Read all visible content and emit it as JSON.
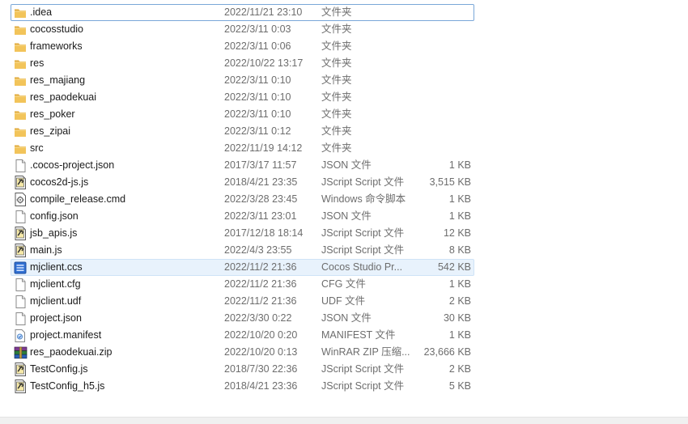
{
  "files": [
    {
      "name": ".idea",
      "date": "2022/11/21 23:10",
      "type": "文件夹",
      "size": "",
      "icon": "folder-icon",
      "state": "focused"
    },
    {
      "name": "cocosstudio",
      "date": "2022/3/11 0:03",
      "type": "文件夹",
      "size": "",
      "icon": "folder-icon"
    },
    {
      "name": "frameworks",
      "date": "2022/3/11 0:06",
      "type": "文件夹",
      "size": "",
      "icon": "folder-icon"
    },
    {
      "name": "res",
      "date": "2022/10/22 13:17",
      "type": "文件夹",
      "size": "",
      "icon": "folder-icon"
    },
    {
      "name": "res_majiang",
      "date": "2022/3/11 0:10",
      "type": "文件夹",
      "size": "",
      "icon": "folder-icon"
    },
    {
      "name": "res_paodekuai",
      "date": "2022/3/11 0:10",
      "type": "文件夹",
      "size": "",
      "icon": "folder-icon"
    },
    {
      "name": "res_poker",
      "date": "2022/3/11 0:10",
      "type": "文件夹",
      "size": "",
      "icon": "folder-icon"
    },
    {
      "name": "res_zipai",
      "date": "2022/3/11 0:12",
      "type": "文件夹",
      "size": "",
      "icon": "folder-icon"
    },
    {
      "name": "src",
      "date": "2022/11/19 14:12",
      "type": "文件夹",
      "size": "",
      "icon": "folder-icon"
    },
    {
      "name": ".cocos-project.json",
      "date": "2017/3/17 11:57",
      "type": "JSON 文件",
      "size": "1 KB",
      "icon": "blank-file-icon"
    },
    {
      "name": "cocos2d-js.js",
      "date": "2018/4/21 23:35",
      "type": "JScript Script 文件",
      "size": "3,515 KB",
      "icon": "jscript-file-icon"
    },
    {
      "name": "compile_release.cmd",
      "date": "2022/3/28 23:45",
      "type": "Windows 命令脚本",
      "size": "1 KB",
      "icon": "cmd-file-icon"
    },
    {
      "name": "config.json",
      "date": "2022/3/11 23:01",
      "type": "JSON 文件",
      "size": "1 KB",
      "icon": "blank-file-icon"
    },
    {
      "name": "jsb_apis.js",
      "date": "2017/12/18 18:14",
      "type": "JScript Script 文件",
      "size": "12 KB",
      "icon": "jscript-file-icon"
    },
    {
      "name": "main.js",
      "date": "2022/4/3 23:55",
      "type": "JScript Script 文件",
      "size": "8 KB",
      "icon": "jscript-file-icon"
    },
    {
      "name": "mjclient.ccs",
      "date": "2022/11/2 21:36",
      "type": "Cocos Studio Pr...",
      "size": "542 KB",
      "icon": "cocos-studio-file-icon",
      "state": "hover"
    },
    {
      "name": "mjclient.cfg",
      "date": "2022/11/2 21:36",
      "type": "CFG 文件",
      "size": "1 KB",
      "icon": "blank-file-icon"
    },
    {
      "name": "mjclient.udf",
      "date": "2022/11/2 21:36",
      "type": "UDF 文件",
      "size": "2 KB",
      "icon": "blank-file-icon"
    },
    {
      "name": "project.json",
      "date": "2022/3/30 0:22",
      "type": "JSON 文件",
      "size": "30 KB",
      "icon": "blank-file-icon"
    },
    {
      "name": "project.manifest",
      "date": "2022/10/20 0:20",
      "type": "MANIFEST 文件",
      "size": "1 KB",
      "icon": "manifest-file-icon"
    },
    {
      "name": "res_paodekuai.zip",
      "date": "2022/10/20 0:13",
      "type": "WinRAR ZIP 压缩...",
      "size": "23,666 KB",
      "icon": "winrar-archive-icon"
    },
    {
      "name": "TestConfig.js",
      "date": "2018/7/30 22:36",
      "type": "JScript Script 文件",
      "size": "2 KB",
      "icon": "jscript-file-icon"
    },
    {
      "name": "TestConfig_h5.js",
      "date": "2018/4/21 23:36",
      "type": "JScript Script 文件",
      "size": "5 KB",
      "icon": "jscript-file-icon"
    }
  ],
  "colors": {
    "folder": "#e8b84a",
    "focus_border": "#7aa7d8",
    "hover_bg": "#e8f2fc",
    "meta_text": "#6d6d6d"
  }
}
